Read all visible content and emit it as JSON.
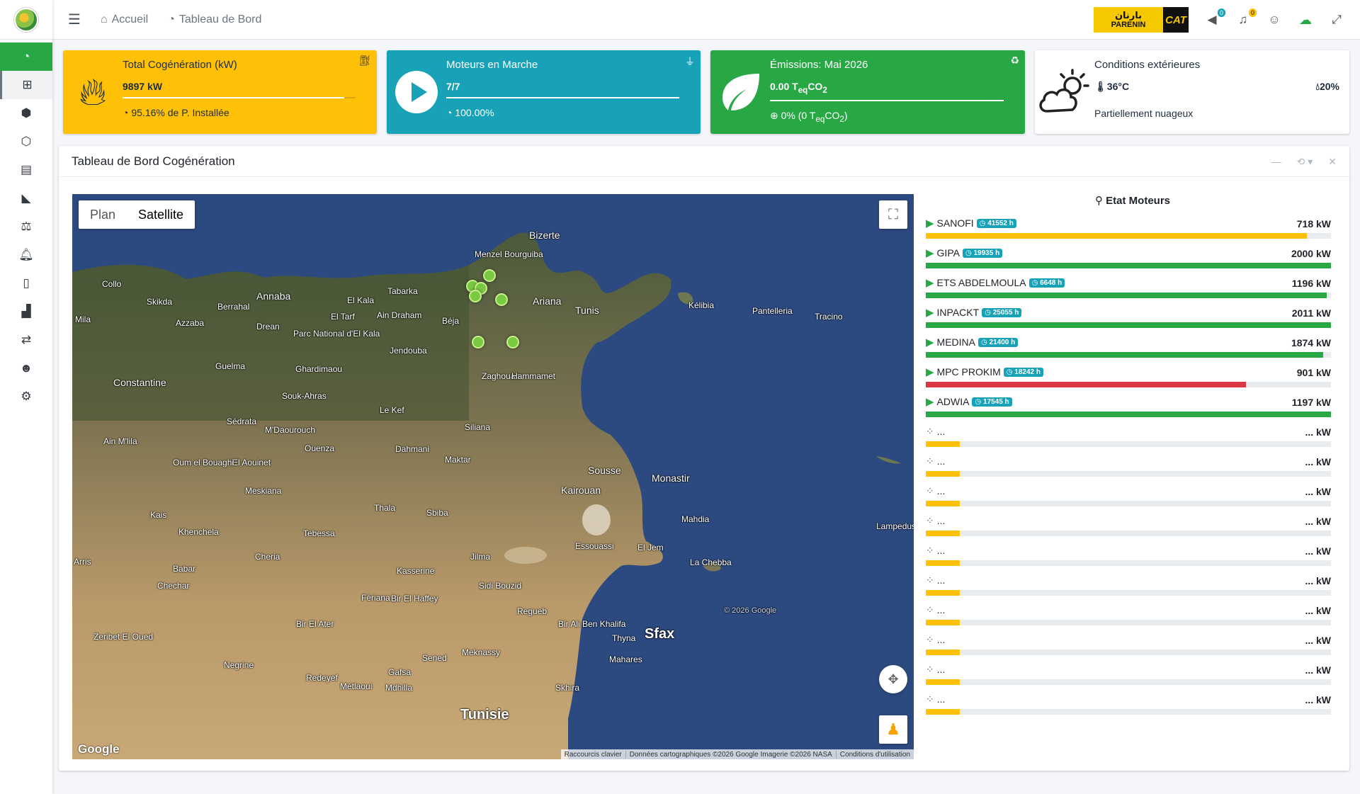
{
  "nav": {
    "home": "Accueil",
    "dashboard": "Tableau de Bord",
    "brand_parenin_ar": "بارنان",
    "brand_parenin": "PARENIN",
    "brand_cat": "CAT",
    "badge_messages": "0",
    "badge_alerts": "0"
  },
  "infoboxes": [
    {
      "title": "Total Cogénération (kW)",
      "value": "9897 kW",
      "progress": 95.16,
      "desc": "95.16% de P. Installée",
      "color": "#ffc107"
    },
    {
      "title": "Moteurs en Marche",
      "value": "7/7",
      "progress": 100,
      "desc": "100.00%",
      "color": "#17a2b8"
    },
    {
      "title": "Émissions: Mai 2026",
      "value_prefix": "0.00 T",
      "value_sub": "eq",
      "value_suffix": "CO",
      "value_sub2": "2",
      "progress": 100,
      "desc_prefix": "0% (0 T",
      "desc_sub": "eq",
      "desc_mid": "CO",
      "desc_sub2": "2",
      "desc_suffix": ")",
      "color": "#28a745"
    },
    {
      "title": "Conditions extérieures",
      "temp": "36°C",
      "humidity": "20%",
      "desc": "Partiellement nuageux"
    }
  ],
  "card": {
    "title": "Tableau de Bord Cogénération"
  },
  "map": {
    "type_plan": "Plan",
    "type_satellite": "Satellite",
    "google": "Google",
    "attrib_shortcuts": "Raccourcis clavier",
    "attrib_data": "Données cartographiques ©2026 Google Imagerie ©2026 NASA",
    "attrib_terms": "Conditions d'utilisation",
    "labels": [
      "Bizerte",
      "Menzel Bourguiba",
      "Ariana",
      "Tunis",
      "Kélibia",
      "Pantelleria",
      "Tracino",
      "Annaba",
      "Skikda",
      "Collo",
      "Mila",
      "Azzaba",
      "Berrahal",
      "Drean",
      "El Kala",
      "El Tarf",
      "Parc National d'El Kala",
      "Tabarka",
      "Ain Draham",
      "Béja",
      "Jendouba",
      "Guelma",
      "Ghardimaou",
      "Constantine",
      "Souk-Ahras",
      "Sédrata",
      "M'Daourouch",
      "Le Kef",
      "Siliana",
      "Ouenza",
      "Dahmani",
      "Zaghouan",
      "Hammamet",
      "Maktar",
      "Sousse",
      "Monastir",
      "Kairouan",
      "El Aouinet",
      "Oum el Bouaghi",
      "Ain M'lila",
      "Meskiana",
      "Thala",
      "Sbiba",
      "Kais",
      "Khenchela",
      "Tebessa",
      "Mahdia",
      "Lampedusa",
      "Essouassi",
      "El Jem",
      "La Chebba",
      "Cheria",
      "Kasserine",
      "Jilma",
      "Arris",
      "Babar",
      "Chechar",
      "Sidi Bouzid",
      "Fériana",
      "Bir El Haffey",
      "Regueb",
      "Bir Ali Ben Khalifa",
      "Thyna",
      "Sfax",
      "Mahares",
      "Bir El Ater",
      "Zeribet El Oued",
      "Sened",
      "Meknassy",
      "Negrine",
      "Gafsa",
      "Redeyef",
      "Métlaoui",
      "Mdhilla",
      "Skhira",
      "Tunisie",
      "© 2026 Google"
    ]
  },
  "engines": {
    "title": "Etat Moteurs",
    "list": [
      {
        "name": "SANOFI",
        "hours": "41552 h",
        "kw": "718 kW",
        "pct": 0.94,
        "status": "warning"
      },
      {
        "name": "GIPA",
        "hours": "19935 h",
        "kw": "2000 kW",
        "pct": 1.0,
        "status": "ok"
      },
      {
        "name": "ETS ABDELMOULA",
        "hours": "6648 h",
        "kw": "1196 kW",
        "pct": 0.99,
        "status": "ok"
      },
      {
        "name": "INPACKT",
        "hours": "25055 h",
        "kw": "2011 kW",
        "pct": 1.0,
        "status": "ok"
      },
      {
        "name": "MEDINA",
        "hours": "21400 h",
        "kw": "1874 kW",
        "pct": 0.98,
        "status": "ok"
      },
      {
        "name": "MPC PROKIM",
        "hours": "18242 h",
        "kw": "901 kW",
        "pct": 0.79,
        "status": "danger"
      },
      {
        "name": "ADWIA",
        "hours": "17545 h",
        "kw": "1197 kW",
        "pct": 1.0,
        "status": "ok"
      }
    ],
    "loading_name": "...",
    "loading_kw": "... kW",
    "loading_count": 10,
    "colors": {
      "ok": "#28a745",
      "warning": "#ffc107",
      "danger": "#dc3545"
    }
  }
}
